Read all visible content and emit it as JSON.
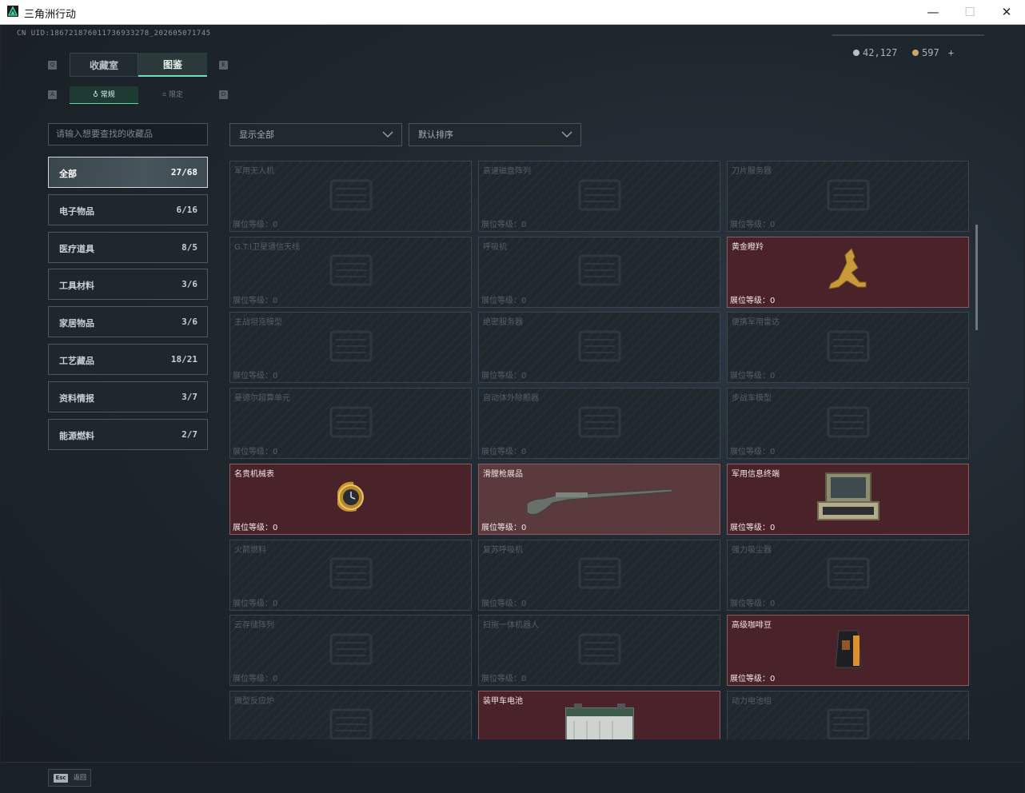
{
  "window": {
    "title": "三角洲行动",
    "minimize": "—",
    "maximize": "☐",
    "close": "✕"
  },
  "uid": "CN UID:1867218760117369332​78_202605071745",
  "currency": {
    "silver": "42,127",
    "gold": "597",
    "plus": "+"
  },
  "tabs": [
    {
      "label": "收藏室"
    },
    {
      "label": "图鉴"
    }
  ],
  "tab_keys": {
    "left": "Q",
    "right": "E"
  },
  "subtabs": [
    {
      "label": "常规"
    },
    {
      "label": "限定"
    }
  ],
  "subtab_keys": {
    "left": "A",
    "right": "D"
  },
  "search": {
    "placeholder": "请输入想要查找的收藏品"
  },
  "filters": {
    "show": "显示全部",
    "sort": "默认排序"
  },
  "categories": [
    {
      "label": "全部",
      "count": "27/68"
    },
    {
      "label": "电子物品",
      "count": "6/16"
    },
    {
      "label": "医疗道具",
      "count": "8/5"
    },
    {
      "label": "工具材料",
      "count": "3/6"
    },
    {
      "label": "家居物品",
      "count": "3/6"
    },
    {
      "label": "工艺藏品",
      "count": "18/21"
    },
    {
      "label": "资料情报",
      "count": "3/7"
    },
    {
      "label": "能源燃料",
      "count": "2/7"
    }
  ],
  "level_label": "展位等级：0",
  "items": [
    {
      "name": "军用无人机",
      "owned": false,
      "icon": "drone-icon"
    },
    {
      "name": "高速磁盘阵列",
      "owned": false,
      "icon": "disk-array-icon"
    },
    {
      "name": "刀片服务器",
      "owned": false,
      "icon": "blade-server-icon"
    },
    {
      "name": "G.T.I卫星通信天线",
      "owned": false,
      "icon": "satellite-dish-icon"
    },
    {
      "name": "呼吸机",
      "owned": false,
      "icon": "ventilator-icon"
    },
    {
      "name": "黄金瞪羚",
      "owned": true,
      "icon": "golden-gazelle-icon"
    },
    {
      "name": "主战坦克模型",
      "owned": false,
      "icon": "tank-model-icon"
    },
    {
      "name": "绝密服务器",
      "owned": false,
      "icon": "server-icon"
    },
    {
      "name": "便携军用雷达",
      "owned": false,
      "icon": "radar-icon"
    },
    {
      "name": "曼德尔超算单元",
      "owned": false,
      "icon": "supercomputer-icon"
    },
    {
      "name": "自动体外除颤器",
      "owned": false,
      "icon": "defibrillator-icon"
    },
    {
      "name": "步战车模型",
      "owned": false,
      "icon": "ifv-model-icon"
    },
    {
      "name": "名贵机械表",
      "owned": true,
      "icon": "watch-icon"
    },
    {
      "name": "滑膛枪展品",
      "owned": true,
      "icon": "musket-icon"
    },
    {
      "name": "军用信息终端",
      "owned": true,
      "icon": "terminal-icon"
    },
    {
      "name": "火箭燃料",
      "owned": false,
      "icon": "rocket-fuel-icon"
    },
    {
      "name": "复苏呼吸机",
      "owned": false,
      "icon": "resuscitator-icon"
    },
    {
      "name": "强力吸尘器",
      "owned": false,
      "icon": "vacuum-icon"
    },
    {
      "name": "云存储阵列",
      "owned": false,
      "icon": "cloud-storage-icon"
    },
    {
      "name": "扫拖一体机器人",
      "owned": false,
      "icon": "robot-vacuum-icon"
    },
    {
      "name": "高级咖啡豆",
      "owned": true,
      "icon": "coffee-bag-icon"
    },
    {
      "name": "微型反应炉",
      "owned": false,
      "icon": "reactor-icon"
    },
    {
      "name": "装甲车电池",
      "owned": true,
      "icon": "battery-icon"
    },
    {
      "name": "动力电池组",
      "owned": false,
      "icon": "battery-pack-icon"
    }
  ],
  "footer": {
    "esc_key": "Esc",
    "esc_label": "返回"
  },
  "colors": {
    "owned_bg": "#4a2229",
    "accent": "#6fe3b8",
    "card_bg": "#20282e"
  }
}
